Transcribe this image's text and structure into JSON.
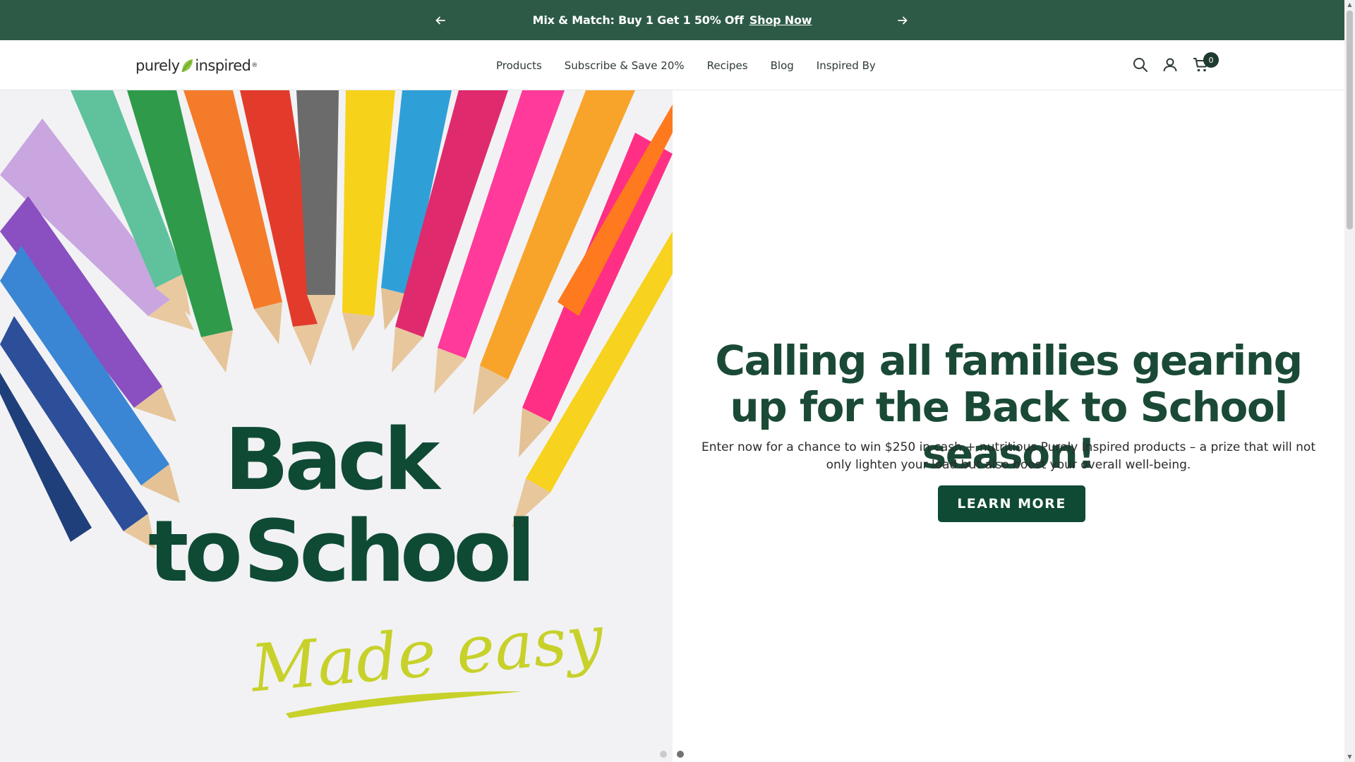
{
  "announcement": {
    "message": "Mix & Match: Buy 1 Get 1 50% Off",
    "link": "Shop Now",
    "background": "#2d5a46"
  },
  "header": {
    "logo": {
      "part1": "purely",
      "part2": "inspired",
      "mark": "®"
    },
    "nav": [
      "Products",
      "Subscribe & Save 20%",
      "Recipes",
      "Blog",
      "Inspired By"
    ],
    "cart_count": "0",
    "icons": [
      "search-icon",
      "account-icon",
      "cart-icon"
    ]
  },
  "hero": {
    "image_text": {
      "line1": "Back",
      "line2a": "to",
      "line2b": "School",
      "line3": "Made easy"
    },
    "title": "Calling all families gearing up for the Back to School season!",
    "text": "Enter now for a chance to win $250 in cash + nutritious Purely Inspired products – a prize that will not only lighten your load but also boost your overall well-being.",
    "button": "LEARN MORE",
    "accent": "#0e4a34",
    "slides": 2,
    "active_slide": 2
  }
}
